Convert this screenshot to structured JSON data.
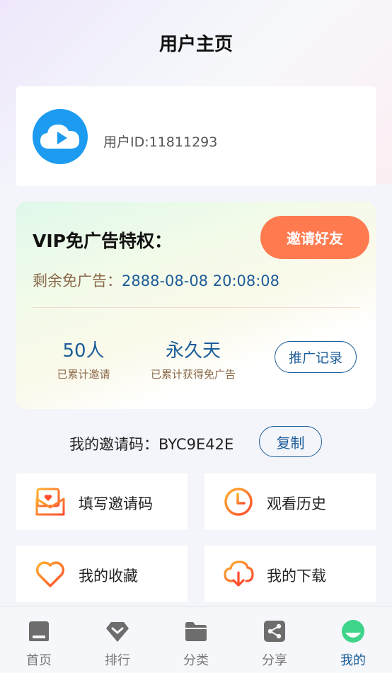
{
  "page": {
    "title": "用户主页"
  },
  "user": {
    "id_text": "用户ID:11811293"
  },
  "vip": {
    "title": "VIP免广告特权：",
    "invite_label": "邀请好友",
    "remain_label": "剩余免广告：",
    "remain_value": "2888-08-08 20:08:08",
    "invited_count": "50人",
    "invited_label": "已累计邀请",
    "adfree_value": "永久天",
    "adfree_label": "已累计获得免广告",
    "records_label": "推广记录"
  },
  "invite_code": {
    "text": "我的邀请码：BYC9E42E",
    "copy_label": "复制"
  },
  "menu": [
    {
      "label": "填写邀请码",
      "icon": "invite-letter-icon"
    },
    {
      "label": "观看历史",
      "icon": "clock-icon"
    },
    {
      "label": "我的收藏",
      "icon": "heart-icon"
    },
    {
      "label": "我的下载",
      "icon": "cloud-download-icon"
    }
  ],
  "tabs": [
    {
      "label": "首页",
      "icon": "home-icon"
    },
    {
      "label": "排行",
      "icon": "diamond-icon"
    },
    {
      "label": "分类",
      "icon": "folder-icon"
    },
    {
      "label": "分享",
      "icon": "share-icon"
    },
    {
      "label": "我的",
      "icon": "profile-icon",
      "active": true
    }
  ],
  "colors": {
    "accent": "#1c5d99",
    "orange": "#ff7a4f",
    "tab_active_icon": "#3ed48a"
  }
}
